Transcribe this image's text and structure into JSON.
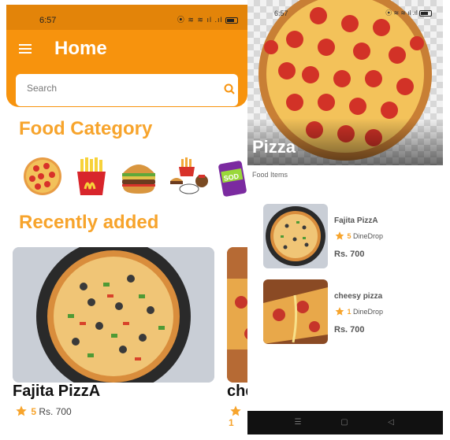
{
  "left_screen": {
    "status_bar": {
      "time": "6:57",
      "icons": "⦿ ≋ ≋ ıl .ıl"
    },
    "header": {
      "title": "Home"
    },
    "search": {
      "placeholder": "Search"
    },
    "sections": {
      "food_category": "Food Category",
      "recently_added": "Recently added"
    },
    "categories": [
      {
        "icon": "pepperoni-pizza-icon"
      },
      {
        "icon": "fries-icon"
      },
      {
        "icon": "burger-icon"
      },
      {
        "icon": "meal-combo-icon"
      },
      {
        "icon": "soda-can-icon"
      }
    ],
    "recent_items": [
      {
        "name": "Fajita PizzA",
        "rating": "5",
        "price": "Rs. 700"
      },
      {
        "name": "che",
        "rating": "1"
      }
    ]
  },
  "right_screen": {
    "status_bar": {
      "time": "6:57",
      "icons": "⦿ ≋ ≋ ıl .ıl"
    },
    "hero_title": "Pizza",
    "sub_label": "Food Items",
    "items": [
      {
        "name": "Fajita PizzA",
        "rating": "5",
        "restaurant": "DineDrop",
        "price": "Rs. 700"
      },
      {
        "name": "cheesy pizza",
        "rating": "1",
        "restaurant": "DineDrop",
        "price": "Rs. 700"
      }
    ],
    "nav": {
      "menu": "☰",
      "home": "▢",
      "back": "◁"
    }
  },
  "colors": {
    "primary": "#f7930d",
    "accent_text": "#f7a42c",
    "star": "#f7a42c"
  }
}
